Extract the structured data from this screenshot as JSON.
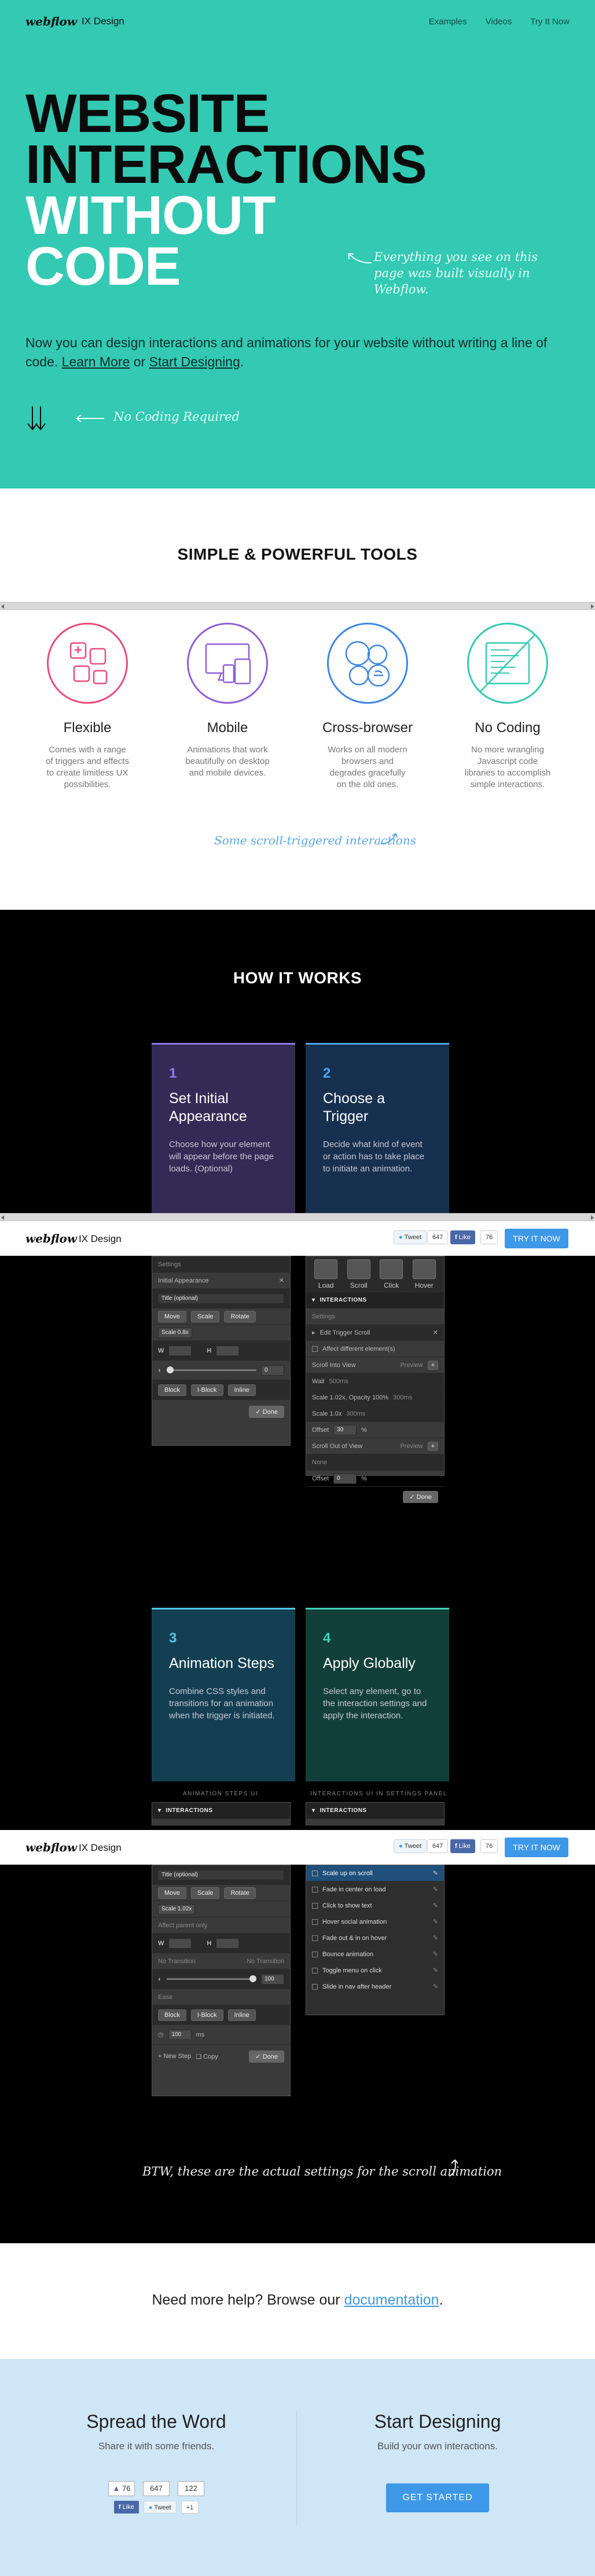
{
  "header": {
    "brand": "webflow",
    "product": "IX Design",
    "nav": [
      "Examples",
      "Videos",
      "Try It Now"
    ]
  },
  "hero": {
    "title_lines": [
      "WEBSITE",
      "INTERACTIONS",
      "WITHOUT",
      "CODE"
    ],
    "note": "Everything you see on this page was built visually in Webflow.",
    "description_prefix": "Now you can design interactions and animations for your website without writing a line of code.",
    "learn_more": "Learn More",
    "or": "or",
    "start_designing": "Start Designing",
    "period": ".",
    "no_coding": "No Coding Required"
  },
  "tools": {
    "title": "SIMPLE & POWERFUL TOOLS",
    "items": [
      {
        "title": "Flexible",
        "desc": "Comes with a range of triggers and effects to create limitless UX possibilities.",
        "color": "#e94b7a",
        "icon": "flexible-icon"
      },
      {
        "title": "Mobile",
        "desc": "Animations that work beautifully on desktop and mobile devices.",
        "color": "#8f5fd6",
        "icon": "mobile-icon"
      },
      {
        "title": "Cross-browser",
        "desc": "Works on all modern browsers and degrades gracefully on the old ones.",
        "color": "#3e86e0",
        "icon": "cross-browser-icon"
      },
      {
        "title": "No Coding",
        "desc": "No more wrangling Javascript code libraries to accomplish simple interactions.",
        "color": "#33c9b3",
        "icon": "code-icon"
      }
    ],
    "scroll_note": "Some scroll-triggered interactions"
  },
  "how": {
    "title": "HOW IT WORKS",
    "steps": [
      {
        "num": "1",
        "title": "Set Initial Appearance",
        "desc": "Choose how your element will appear before the page loads. (Optional)",
        "bg": "#332a55",
        "accent": "#8f7be8"
      },
      {
        "num": "2",
        "title": "Choose a Trigger",
        "desc": "Decide what kind of event or action has to take place to initiate an animation.",
        "bg": "#17304f",
        "accent": "#4fa3f0"
      },
      {
        "num": "3",
        "title": "Animation Steps",
        "desc": "Combine CSS styles and transitions for an animation when the trigger is initiated.",
        "bg": "#143f52",
        "accent": "#4fc6e8"
      },
      {
        "num": "4",
        "title": "Apply Globally",
        "desc": "Select any element, go to the interaction settings and apply the interaction.",
        "bg": "#123f3a",
        "accent": "#40d2b7"
      }
    ],
    "panel1": {
      "settings": "Settings",
      "initial": "Initial Appearance",
      "class_label": "Title (optional)",
      "move": "Move",
      "scale": "Scale",
      "rotate": "Rotate",
      "scale_val": "Scale 0.8x",
      "w": "W",
      "h": "H",
      "opacity_val": "0",
      "block": "Block",
      "iblock": "I-Block",
      "inline": "Inline",
      "done": "Done"
    },
    "panel2": {
      "triggers": [
        "Load",
        "Scroll",
        "Click",
        "Hover"
      ],
      "interactions": "INTERACTIONS",
      "settings": "Settings",
      "edit_trigger": "Edit Trigger Scroll",
      "affect": "Affect different element(s)",
      "scroll_into": "Scroll Into View",
      "preview": "Preview",
      "row1": "Wait",
      "row1_b": "500ms",
      "row2": "Scale 1.02x, Opacity 100%",
      "row2_b": "300ms",
      "row3": "Scale 1.0x",
      "row3_b": "300ms",
      "offset": "Offset",
      "offset_val": "30",
      "percent": "%",
      "scroll_out": "Scroll Out of View",
      "none": "None",
      "offset2_val": "0",
      "done": "Done"
    },
    "captions": [
      "ANIMATION STEPS UI",
      "INTERACTIONS UI IN SETTINGS PANEL"
    ],
    "panel3": {
      "interactions": "INTERACTIONS",
      "class_label": "Title (optional)",
      "move": "Move",
      "scale": "Scale",
      "rotate": "Rotate",
      "scale_val": "Scale 1.02x",
      "affect": "Affect parent only",
      "no_transition": "No Transition",
      "ease": "Ease",
      "opacity": "100",
      "block": "Block",
      "iblock": "I-Block",
      "inline": "Inline",
      "delay": "100",
      "delay_unit": "ms",
      "new_step": "New Step",
      "copy": "Copy",
      "done": "Done"
    },
    "panel4": {
      "interactions": "INTERACTIONS",
      "items": [
        "Scale up on scroll",
        "Fade in center on load",
        "Click to show text",
        "Hover social animation",
        "Fade out & in on hover",
        "Bounce animation",
        "Toggle menu on click",
        "Slide in nav after header"
      ]
    },
    "btw": "BTW, these are the actual settings for the scroll animation"
  },
  "sticky": {
    "tweet": "Tweet",
    "tweet_count": "647",
    "like": "Like",
    "like_count": "76",
    "try_now": "TRY IT NOW"
  },
  "help": {
    "prefix": "Need more help? Browse our",
    "link": "documentation",
    "suffix": "."
  },
  "footer": {
    "spread_title": "Spread the Word",
    "spread_sub": "Share it with some friends.",
    "counts": [
      "76",
      "647",
      "122"
    ],
    "like": "Like",
    "tweet": "Tweet",
    "plus": "+1",
    "start_title": "Start Designing",
    "start_sub": "Build your own interactions.",
    "get_started": "GET STARTED"
  },
  "colors": {
    "hero_bg": "#33c9b3",
    "accent_blue": "#3e98e8",
    "footer_bg": "#cfe6f7"
  }
}
